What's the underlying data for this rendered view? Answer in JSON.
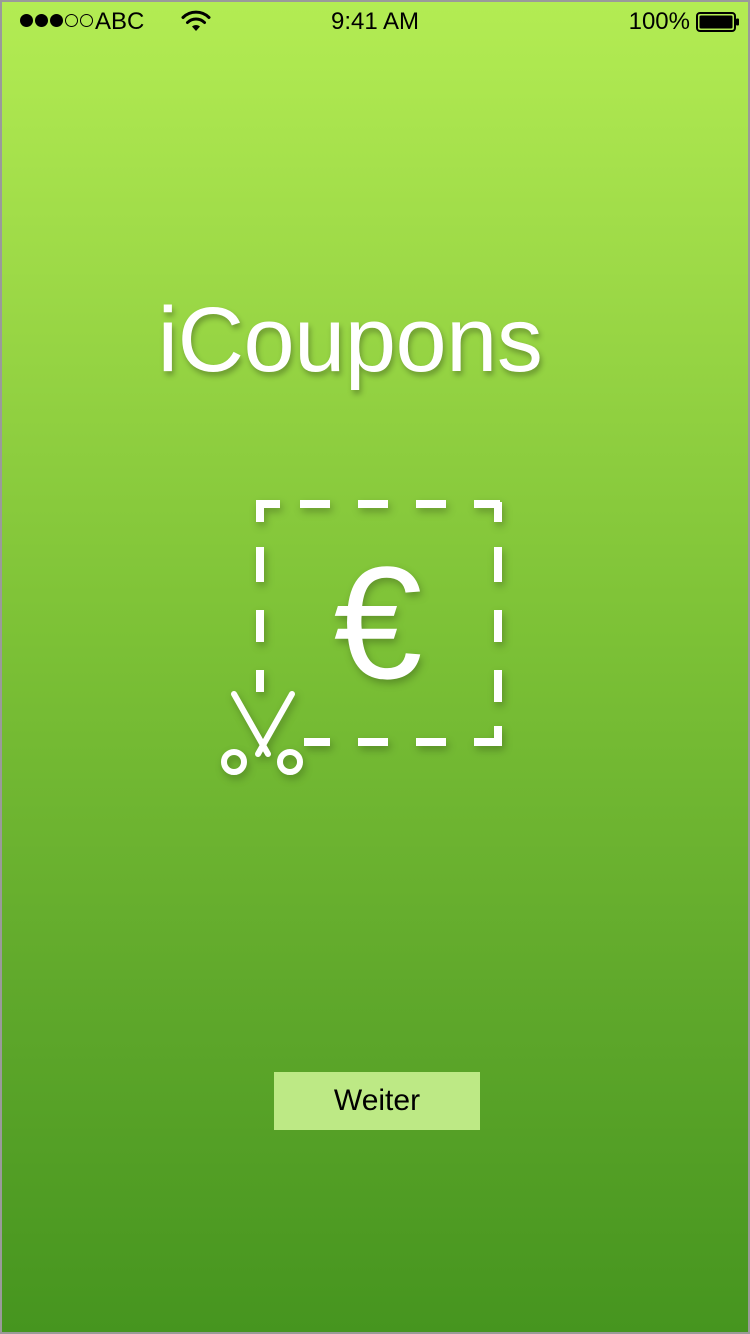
{
  "status_bar": {
    "signal_dots_filled": 3,
    "signal_dots_total": 5,
    "carrier": "ABC",
    "time": "9:41 AM",
    "battery_percent": "100%",
    "icons": [
      "wifi-icon",
      "battery-icon"
    ]
  },
  "splash": {
    "title": "iCoupons",
    "logo": {
      "symbol": "€",
      "icons": [
        "coupon-dashed-border-icon",
        "scissors-icon"
      ]
    },
    "next_button_label": "Weiter"
  },
  "colors": {
    "background_top": "#b3ec53",
    "background_bottom": "#46951f",
    "button_background": "#bde985",
    "title_color": "#ffffff"
  }
}
